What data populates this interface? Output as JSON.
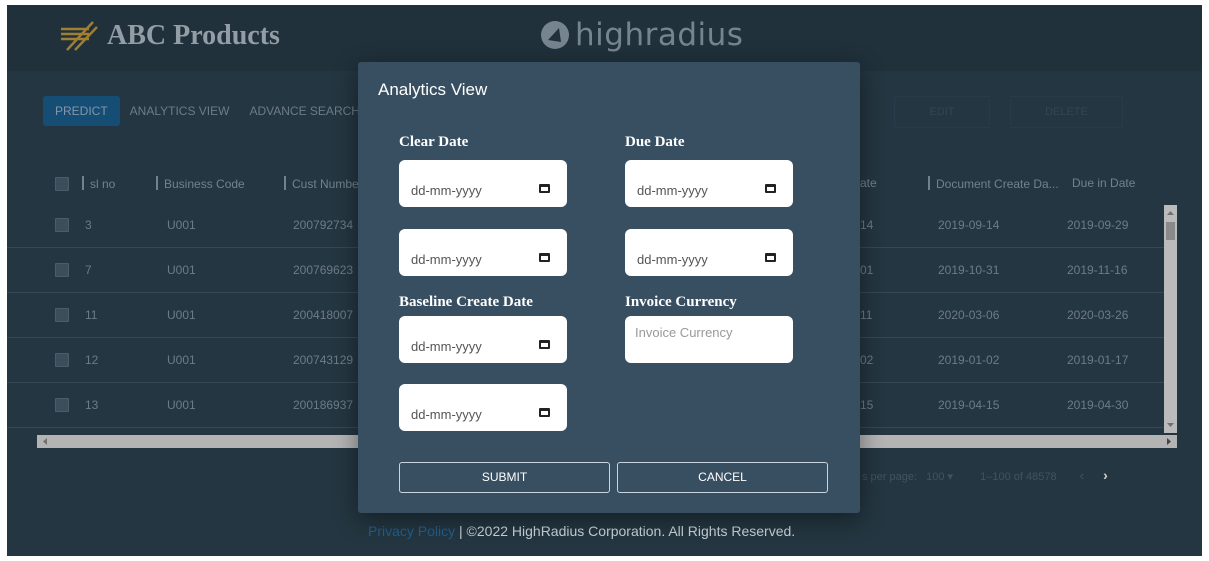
{
  "header": {
    "logo_text": "ABC Products",
    "brand_text": "highradius"
  },
  "toolbar": {
    "predict": "PREDICT",
    "analytics_view": "ANALYTICS VIEW",
    "advance_search": "ADVANCE SEARCH",
    "edit": "EDIT",
    "delete": "DELETE"
  },
  "table": {
    "columns": [
      "sl no",
      "Business Code",
      "Cust Numbe",
      "ate",
      "Document Create Da...",
      "Due in Date"
    ],
    "rows": [
      {
        "sl_no": "3",
        "business_code": "U001",
        "cust_number": "200792734",
        "partial": "14",
        "doc_create_date": "2019-09-14",
        "due_in_date": "2019-09-29"
      },
      {
        "sl_no": "7",
        "business_code": "U001",
        "cust_number": "200769623",
        "partial": "01",
        "doc_create_date": "2019-10-31",
        "due_in_date": "2019-11-16"
      },
      {
        "sl_no": "11",
        "business_code": "U001",
        "cust_number": "200418007",
        "partial": "11",
        "doc_create_date": "2020-03-06",
        "due_in_date": "2020-03-26"
      },
      {
        "sl_no": "12",
        "business_code": "U001",
        "cust_number": "200743129",
        "partial": "02",
        "doc_create_date": "2019-01-02",
        "due_in_date": "2019-01-17"
      },
      {
        "sl_no": "13",
        "business_code": "U001",
        "cust_number": "200186937",
        "partial": "15",
        "doc_create_date": "2019-04-15",
        "due_in_date": "2019-04-30"
      }
    ]
  },
  "pagination": {
    "rows_label": "s per page:",
    "rows_value": "100",
    "range": "1–100 of 48578"
  },
  "footer": {
    "link": "Privacy Policy",
    "text": " | ©2022 HighRadius Corporation. All Rights Reserved."
  },
  "dialog": {
    "title": "Analytics View",
    "clear_date_label": "Clear Date",
    "due_date_label": "Due Date",
    "baseline_label": "Baseline Create Date",
    "currency_label": "Invoice Currency",
    "date_placeholder": "dd-mm-yyyy",
    "currency_placeholder": "Invoice Currency",
    "submit": "SUBMIT",
    "cancel": "CANCEL"
  },
  "colors": {
    "app_bg": "#2d4250",
    "dialog_bg": "#384f62",
    "primary": "#1a5e8f"
  }
}
